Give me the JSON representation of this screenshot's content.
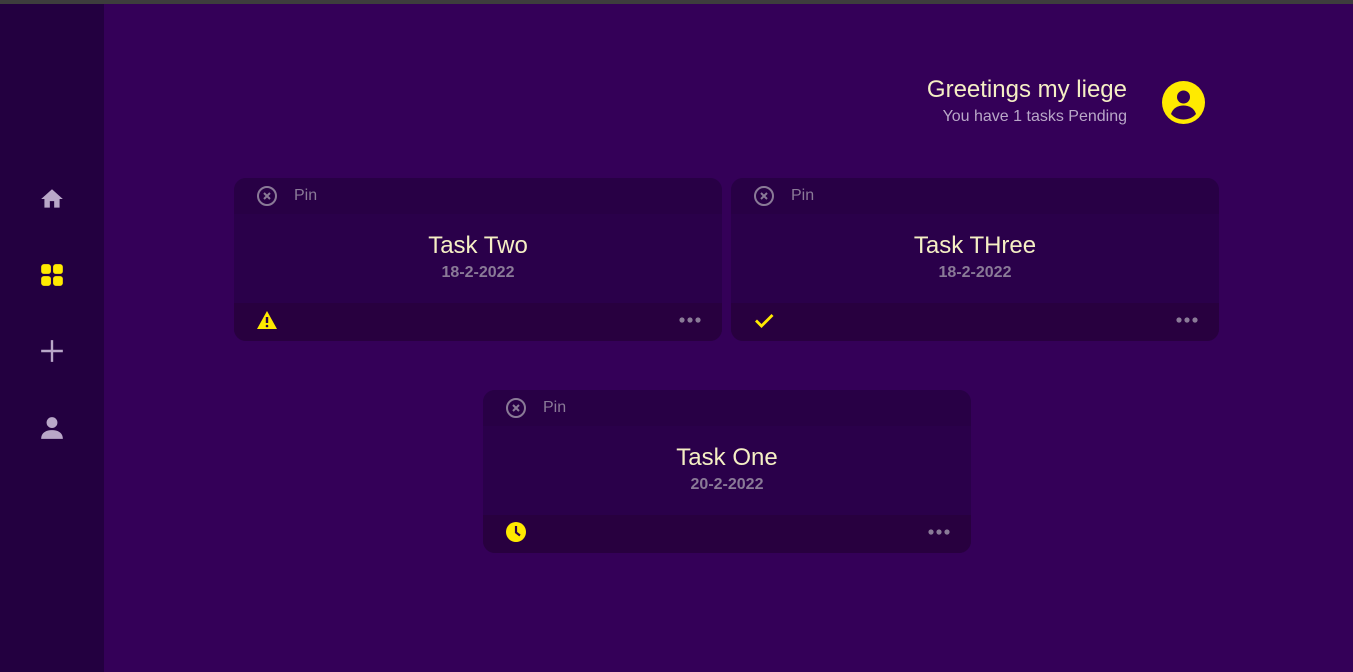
{
  "sidebar": {
    "items": [
      {
        "name": "home",
        "icon": "home-icon",
        "active": false
      },
      {
        "name": "dashboard",
        "icon": "dashboard-icon",
        "active": true
      },
      {
        "name": "add",
        "icon": "plus-icon",
        "active": false
      },
      {
        "name": "profile",
        "icon": "person-icon",
        "active": false
      }
    ]
  },
  "header": {
    "title": "Greetings my liege",
    "subtitle": "You have 1 tasks Pending",
    "avatar_icon": "account-circle-icon"
  },
  "tasks": [
    {
      "title": "Task Two",
      "date": "18-2-2022",
      "pin_label": "Pin",
      "status_icon": "warning-icon"
    },
    {
      "title": "Task THree",
      "date": "18-2-2022",
      "pin_label": "Pin",
      "status_icon": "check-icon"
    },
    {
      "title": "Task One",
      "date": "20-2-2022",
      "pin_label": "Pin",
      "status_icon": "clock-icon"
    }
  ],
  "colors": {
    "background": "#340058",
    "sidebar": "#230040",
    "card": "#2a004a",
    "accent": "#ffea00",
    "text": "#f5efc4",
    "muted": "#8a7a97"
  }
}
